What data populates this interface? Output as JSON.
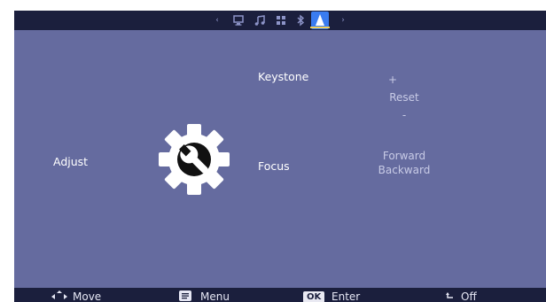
{
  "topbar": {
    "prev_arrow": "‹",
    "next_arrow": "›",
    "tabs": [
      {
        "icon": "monitor-icon",
        "active": false
      },
      {
        "icon": "music-icon",
        "active": false
      },
      {
        "icon": "grid-icon",
        "active": false
      },
      {
        "icon": "bluetooth-icon",
        "active": false
      },
      {
        "icon": "projector-cone-icon",
        "active": true
      }
    ],
    "active_color": "#3a7cf0",
    "underline_color": "#f2d15a"
  },
  "section": {
    "title": "Adjust",
    "icon": "settings-wrench-icon"
  },
  "settings": {
    "keystone": {
      "label": "Keystone",
      "plus": "+",
      "reset": "Reset",
      "minus": "-"
    },
    "focus": {
      "label": "Focus",
      "forward": "Forward",
      "backward": "Backward"
    }
  },
  "bottombar": {
    "move_label": "Move",
    "menu_label": "Menu",
    "enter_key": "OK",
    "enter_label": "Enter",
    "off_label": "Off"
  },
  "colors": {
    "background": "#656b9f",
    "bar": "#1b1f3d",
    "text": "#ffffff",
    "option_text": "#c8cbe6"
  }
}
